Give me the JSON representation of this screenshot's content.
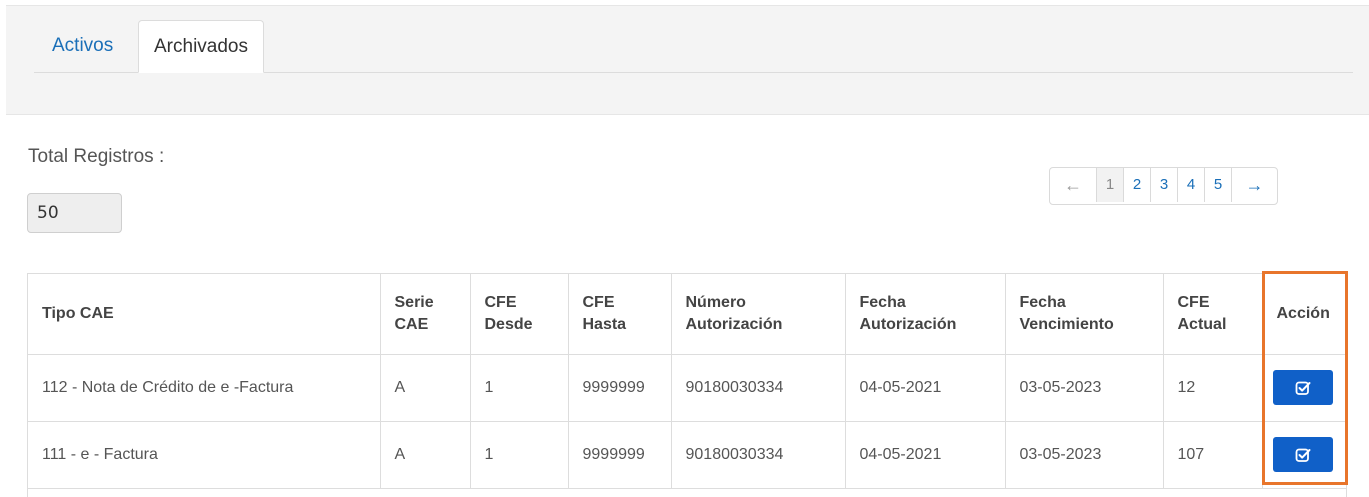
{
  "tabs": [
    {
      "label": "Activos"
    },
    {
      "label": "Archivados"
    }
  ],
  "summary": {
    "total_label": "Total Registros :",
    "total_value": "50"
  },
  "pagination": {
    "prev": "←",
    "next": "→",
    "pages": [
      "1",
      "2",
      "3",
      "4",
      "5"
    ],
    "active_page": "1"
  },
  "table": {
    "headers": [
      [
        "Tipo CAE"
      ],
      [
        "Serie",
        "CAE"
      ],
      [
        "CFE",
        "Desde"
      ],
      [
        "CFE",
        "Hasta"
      ],
      [
        "Número",
        "Autorización"
      ],
      [
        "Fecha",
        "Autorización"
      ],
      [
        "Fecha",
        "Vencimiento"
      ],
      [
        "CFE",
        "Actual"
      ],
      [
        "Acción"
      ]
    ],
    "rows": [
      [
        "112 - Nota de Crédito de e -Factura",
        "A",
        "1",
        "9999999",
        "90180030334",
        "04-05-2021",
        "03-05-2023",
        "12"
      ],
      [
        "111 - e - Factura",
        "A",
        "1",
        "9999999",
        "90180030334",
        "04-05-2021",
        "03-05-2023",
        "107"
      ]
    ],
    "action_icon": "check-square-icon"
  },
  "colors": {
    "link": "#1a6fb8",
    "action_button": "#1060c8",
    "highlight": "#e8752b"
  }
}
